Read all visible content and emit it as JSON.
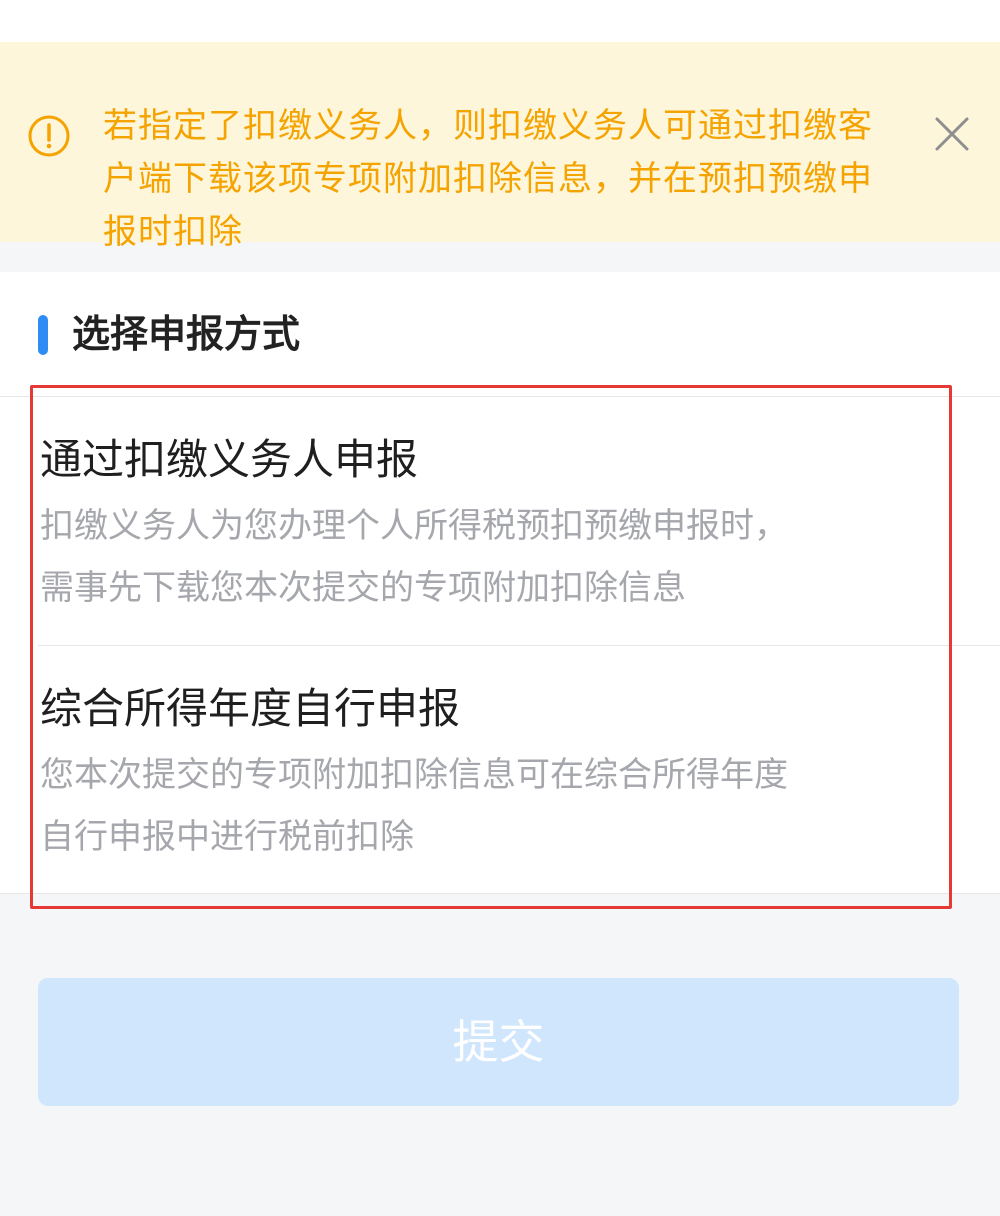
{
  "notice": {
    "text": "若指定了扣缴义务人，则扣缴义务人可通过扣缴客户端下载该项专项附加扣除信息，并在预扣预缴申报时扣除",
    "color": "#f5a300",
    "background": "#fdf6da",
    "icon": "exclamation-circle-icon",
    "close_icon": "close-icon"
  },
  "section": {
    "title": "选择申报方式",
    "accent": "#2f8cf5"
  },
  "options": [
    {
      "title": "通过扣缴义务人申报",
      "description": "扣缴义务人为您办理个人所得税预扣预缴申报时，需事先下载您本次提交的专项附加扣除信息"
    },
    {
      "title": "综合所得年度自行申报",
      "description": "您本次提交的专项附加扣除信息可在综合所得年度自行申报中进行税前扣除"
    }
  ],
  "highlight_color": "#e53935",
  "submit": {
    "label": "提交",
    "background": "#cfe6fc"
  }
}
